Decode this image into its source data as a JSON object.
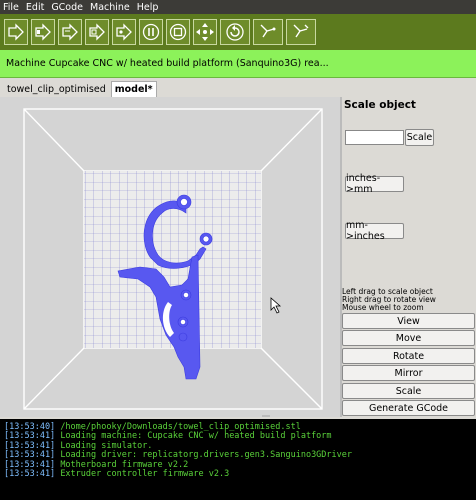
{
  "menu": [
    "File",
    "Edit",
    "GCode",
    "Machine",
    "Help"
  ],
  "toolbar": {
    "buttons": [
      "play-icon",
      "play-icon",
      "build-icon",
      "build-icon",
      "play-icon",
      "pause-icon",
      "stop-icon",
      "move-icon",
      "reset-icon",
      "test-icon",
      "machine-icon"
    ]
  },
  "status": {
    "text": "Machine Cupcake CNC w/ heated build platform (Sanquino3G) rea..."
  },
  "tabs": [
    "towel_clip_optimised",
    "model*"
  ],
  "panel": {
    "title": "Scale object",
    "scale_input_value": "",
    "scale_button": "Scale",
    "inches_to_mm": "inches->mm",
    "mm_to_inches": "mm->inches",
    "hints": [
      "Left drag to scale object",
      "Right drag to rotate view",
      "Mouse wheel to zoom"
    ],
    "actions": [
      "View",
      "Move",
      "Rotate",
      "Mirror",
      "Scale",
      "Generate GCode"
    ]
  },
  "log": [
    {
      "time": "[13:53:40]",
      "msg": "/home/phooky/Downloads/towel_clip_optimised.stl"
    },
    {
      "time": "[13:53:41]",
      "msg": "Loading machine: Cupcake CNC w/ heated build platform"
    },
    {
      "time": "[13:53:41]",
      "msg": "Loading simulator."
    },
    {
      "time": "[13:53:41]",
      "msg": "Loading driver: replicatorg.drivers.gen3.Sanguino3GDriver"
    },
    {
      "time": "[13:53:41]",
      "msg": "Motherboard firmware v2.2"
    },
    {
      "time": "[13:53:41]",
      "msg": "Extruder controller firmware v2.3"
    }
  ],
  "colors": {
    "toolbar": "#5c7a1e",
    "status": "#8cf25a",
    "model": "#5858f0",
    "log_text": "#5ad23a"
  }
}
